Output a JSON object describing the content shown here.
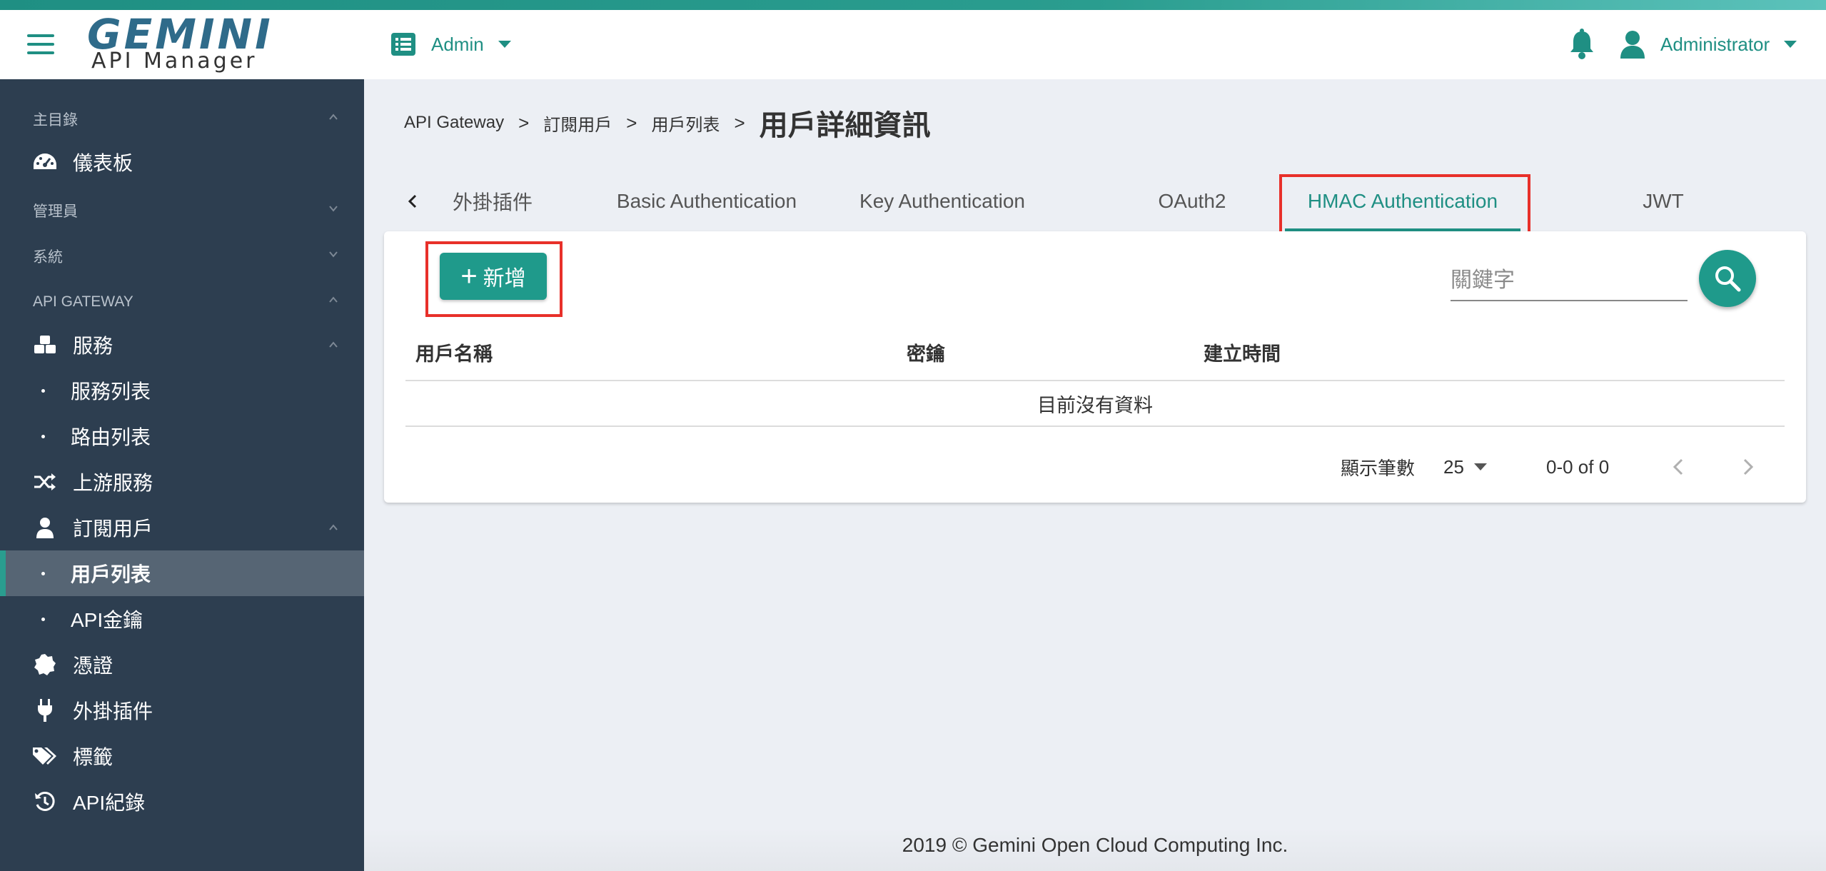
{
  "header": {
    "logo_main": "GEMINI",
    "logo_sub": "API Manager",
    "role": "Admin",
    "user": "Administrator"
  },
  "sidebar": {
    "sections": {
      "main": "主目錄",
      "admin": "管理員",
      "system": "系統",
      "gateway": "API GATEWAY"
    },
    "items": {
      "dashboard": "儀表板",
      "services": "服務",
      "service_list": "服務列表",
      "route_list": "路由列表",
      "upstream": "上游服務",
      "consumers": "訂閱用戶",
      "consumer_list": "用戶列表",
      "api_keys": "API金鑰",
      "certificates": "憑證",
      "plugins": "外掛插件",
      "tags": "標籤",
      "api_logs": "API紀錄"
    }
  },
  "breadcrumb": {
    "root": "API Gateway",
    "level1": "訂閱用戶",
    "level2": "用戶列表",
    "current": "用戶詳細資訊",
    "separator": ">"
  },
  "tabs": {
    "plugins": "外掛插件",
    "basic": "Basic Authentication",
    "key": "Key Authentication",
    "oauth2": "OAuth2",
    "hmac": "HMAC Authentication",
    "jwt": "JWT",
    "active": "hmac"
  },
  "toolbar": {
    "add_label": "新增",
    "search_placeholder": "關鍵字"
  },
  "table": {
    "columns": [
      "用戶名稱",
      "密鑰",
      "建立時間"
    ],
    "empty_text": "目前沒有資料",
    "rows": []
  },
  "pagination": {
    "rows_label": "顯示筆數",
    "rows_per_page": "25",
    "range_text": "0-0 of 0"
  },
  "footer": {
    "copyright": "2019 © Gemini Open Cloud Computing Inc."
  },
  "colors": {
    "accent": "#1f8f83",
    "sidebar_bg": "#2d3e50",
    "highlight": "#e8302a"
  }
}
